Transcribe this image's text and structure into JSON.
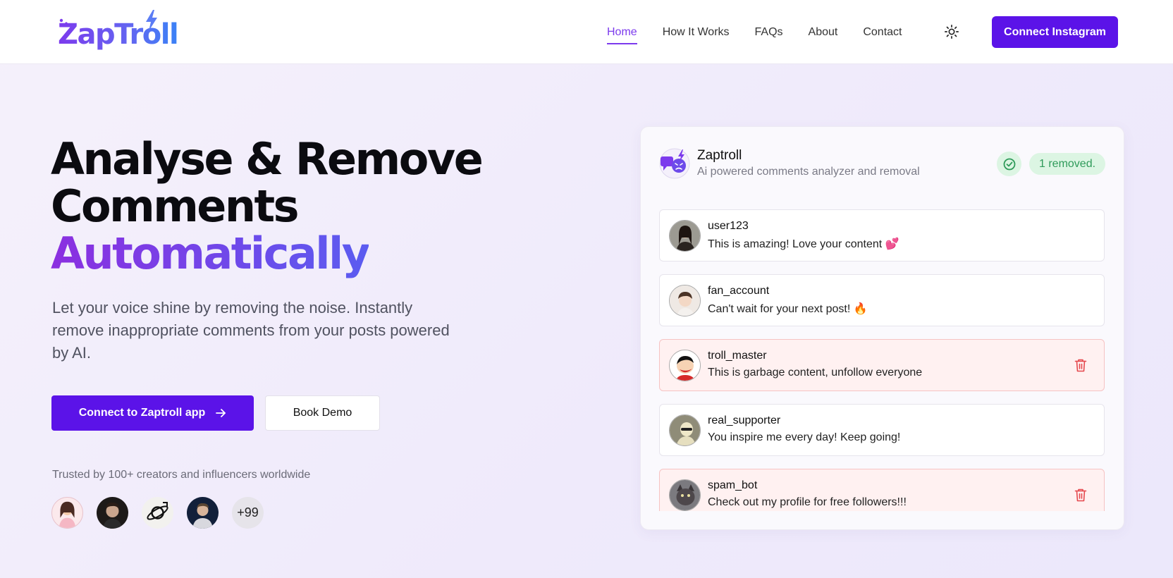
{
  "nav": {
    "brand": "ZapTroll",
    "links": [
      "Home",
      "How It Works",
      "FAQs",
      "About",
      "Contact"
    ],
    "active_link": "Home",
    "theme_icon": "sun-icon",
    "cta": "Connect Instagram"
  },
  "hero": {
    "title_line1": "Analyse & Remove",
    "title_line2": "Comments",
    "title_highlight": "Automatically",
    "subtitle": "Let your voice shine by removing the noise. Instantly remove inappropriate comments from your posts powered by AI.",
    "primary_button": "Connect to Zaptroll app",
    "secondary_button": "Book Demo",
    "trusted_text": "Trusted by 100+ creators and influencers worldwide",
    "more_count": "+99"
  },
  "card": {
    "title": "Zaptroll",
    "subtitle": "Ai powered comments analyzer and removal",
    "status_badge": "1 removed.",
    "comments": [
      {
        "user": "user123",
        "text": "This is amazing! Love your content 💕",
        "flagged": false
      },
      {
        "user": "fan_account",
        "text": "Can't wait for your next post! 🔥",
        "flagged": false
      },
      {
        "user": "troll_master",
        "text": "This is garbage content, unfollow everyone",
        "flagged": true
      },
      {
        "user": "real_supporter",
        "text": "You inspire me every day! Keep going!",
        "flagged": false
      },
      {
        "user": "spam_bot",
        "text": "Check out my profile for free followers!!!",
        "flagged": true
      }
    ]
  },
  "colors": {
    "primary": "#5b13e8",
    "accent": "#7c3aed",
    "flag_bg": "#fff1f1",
    "success": "#2f9b5a"
  }
}
